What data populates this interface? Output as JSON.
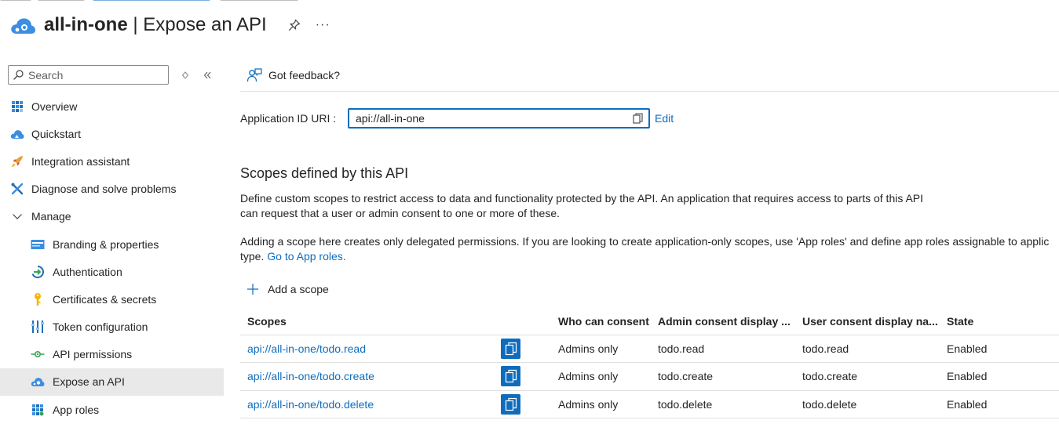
{
  "header": {
    "app_name": "all-in-one",
    "separator": "|",
    "page_name": "Expose an API",
    "more_label": "···"
  },
  "sidebar": {
    "search_placeholder": "Search",
    "items": [
      {
        "label": "Overview",
        "icon": "overview-grid-icon"
      },
      {
        "label": "Quickstart",
        "icon": "quickstart-cloud-icon"
      },
      {
        "label": "Integration assistant",
        "icon": "rocket-icon"
      },
      {
        "label": "Diagnose and solve problems",
        "icon": "wrench-icon"
      },
      {
        "label": "Manage",
        "icon": "chevron-down-icon"
      },
      {
        "label": "Branding & properties",
        "icon": "branding-icon"
      },
      {
        "label": "Authentication",
        "icon": "authentication-icon"
      },
      {
        "label": "Certificates & secrets",
        "icon": "key-icon"
      },
      {
        "label": "Token configuration",
        "icon": "token-bars-icon"
      },
      {
        "label": "API permissions",
        "icon": "api-permissions-icon"
      },
      {
        "label": "Expose an API",
        "icon": "expose-api-cloud-icon"
      },
      {
        "label": "App roles",
        "icon": "app-roles-grid-icon"
      }
    ]
  },
  "main": {
    "feedback_label": "Got feedback?",
    "app_id_label": "Application ID URI :",
    "app_id_value": "api://all-in-one",
    "edit_label": "Edit",
    "section_title": "Scopes defined by this API",
    "description_1": "Define custom scopes to restrict access to data and functionality protected by the API. An application that requires access to parts of this API can request that a user or admin consent to one or more of these.",
    "description_2_line1": "Adding a scope here creates only delegated permissions. If you are looking to create application-only scopes, use 'App roles' and define app roles assignable to applic",
    "description_2_line2": "type.",
    "go_to_app_roles": "Go to App roles.",
    "add_scope_label": "Add a scope",
    "table": {
      "headers": [
        "Scopes",
        "Who can consent",
        "Admin consent display ...",
        "User consent display na...",
        "State"
      ],
      "rows": [
        {
          "scope": "api://all-in-one/todo.read",
          "who": "Admins only",
          "admin": "todo.read",
          "user": "todo.read",
          "state": "Enabled"
        },
        {
          "scope": "api://all-in-one/todo.create",
          "who": "Admins only",
          "admin": "todo.create",
          "user": "todo.create",
          "state": "Enabled"
        },
        {
          "scope": "api://all-in-one/todo.delete",
          "who": "Admins only",
          "admin": "todo.delete",
          "user": "todo.delete",
          "state": "Enabled"
        }
      ]
    }
  },
  "colors": {
    "accent": "#0f6cbd",
    "selected_bg": "#e9e9e9",
    "divider": "#e1dfdd"
  }
}
